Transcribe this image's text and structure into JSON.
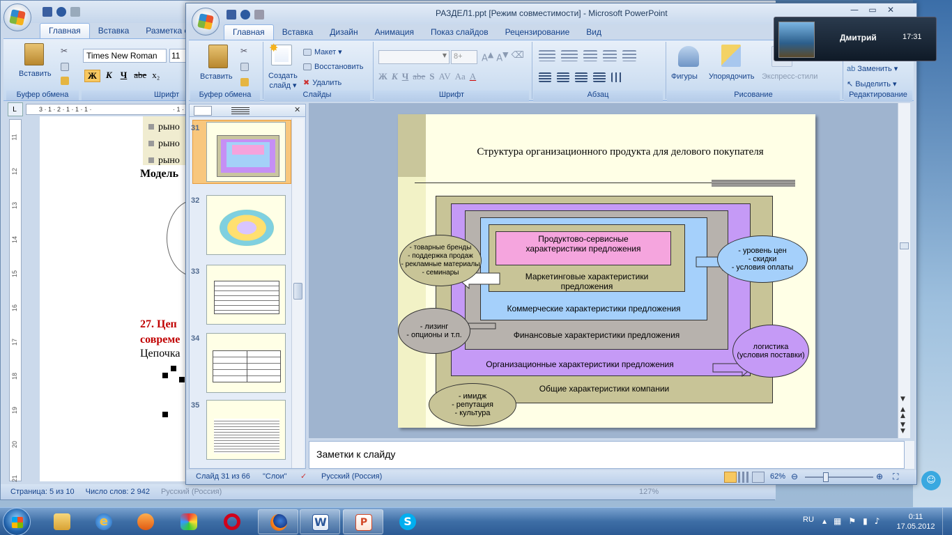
{
  "word": {
    "tabs": [
      "Главная",
      "Вставка",
      "Разметка с"
    ],
    "font_name": "Times New Roman",
    "font_size": "11",
    "groups": {
      "clipboard": "Буфер обмена",
      "font": "Шрифт"
    },
    "paste": "Вставить",
    "fmt": {
      "bold": "Ж",
      "italic": "К",
      "underline": "Ч",
      "strike": "abe",
      "sub": "x₂"
    },
    "ruler": "3 · 1 · 2 · 1 · 1 · 1 ·",
    "ruler_right": "· 1 ·",
    "vruler": [
      "11",
      "12",
      "13",
      "14",
      "15",
      "16",
      "17",
      "18",
      "19",
      "20",
      "21"
    ],
    "doc_lines": [
      "рыно",
      "рыно",
      "рыно"
    ],
    "model": "Модель",
    "heading1": "27. Цеп",
    "heading2": "совреме",
    "chain": "Цепочка",
    "status": {
      "page": "Страница: 5 из 10",
      "words": "Число слов: 2 942",
      "lang": "Русский (Россия)",
      "zoom": "127%"
    }
  },
  "ppt": {
    "title": "РАЗДЕЛ1.ppt [Режим совместимости] - Microsoft PowerPoint",
    "tabs": [
      "Главная",
      "Вставка",
      "Дизайн",
      "Анимация",
      "Показ слайдов",
      "Рецензирование",
      "Вид"
    ],
    "groups": {
      "clipboard": "Буфер обмена",
      "slides": "Слайды",
      "font": "Шрифт",
      "paragraph": "Абзац",
      "drawing": "Рисование",
      "editing": "Редактирование"
    },
    "buttons": {
      "paste": "Вставить",
      "new_slide": "Создать\nслайд ▾",
      "layout": "Макет ▾",
      "reset": "Восстановить",
      "delete": "Удалить",
      "shapes": "Фигуры",
      "arrange": "Упорядочить",
      "quick_styles": "Экспресс-стили",
      "replace": "Заменить ▾",
      "select": "Выделить ▾"
    },
    "font_size_placeholder": "8+",
    "fmt": {
      "bold": "Ж",
      "italic": "К",
      "underline": "Ч",
      "strike": "abe",
      "shadow": "S",
      "spacing": "AV",
      "case": "Aa",
      "color": "A"
    },
    "thumb_numbers": [
      "31",
      "32",
      "33",
      "34",
      "35"
    ],
    "notes": "Заметки к слайду",
    "status": {
      "slide": "Слайд 31 из 66",
      "theme": "\"Слои\"",
      "lang": "Русский (Россия)",
      "zoom": "62%"
    }
  },
  "slide": {
    "title": "Структура организационного продукта для делового покупателя",
    "layers": {
      "l1": "Продуктово-сервисные\nхарактеристики предложения",
      "l2": "Маркетинговые характеристики\nпредложения",
      "l3": "Коммерческие характеристики предложения",
      "l4": "Финансовые характеристики предложения",
      "l5": "Организационные  характеристики предложения",
      "l6": "Общие характеристики компании"
    },
    "ellipses": {
      "marketing": "- товарные бренды\n- поддержка продаж\n- рекламные материалы\n- семинары",
      "commercial": "- уровень цен\n- скидки\n- условия оплаты",
      "finance": "- лизинг\n- опционы и т.п.",
      "logistics": "логистика\n(условия поставки)",
      "company": "- имидж\n- репутация\n- культура"
    }
  },
  "notification": {
    "name": "Дмитрий",
    "time": "17:31"
  },
  "tray": {
    "lang": "RU",
    "time": "0:11",
    "date": "17.05.2012"
  }
}
